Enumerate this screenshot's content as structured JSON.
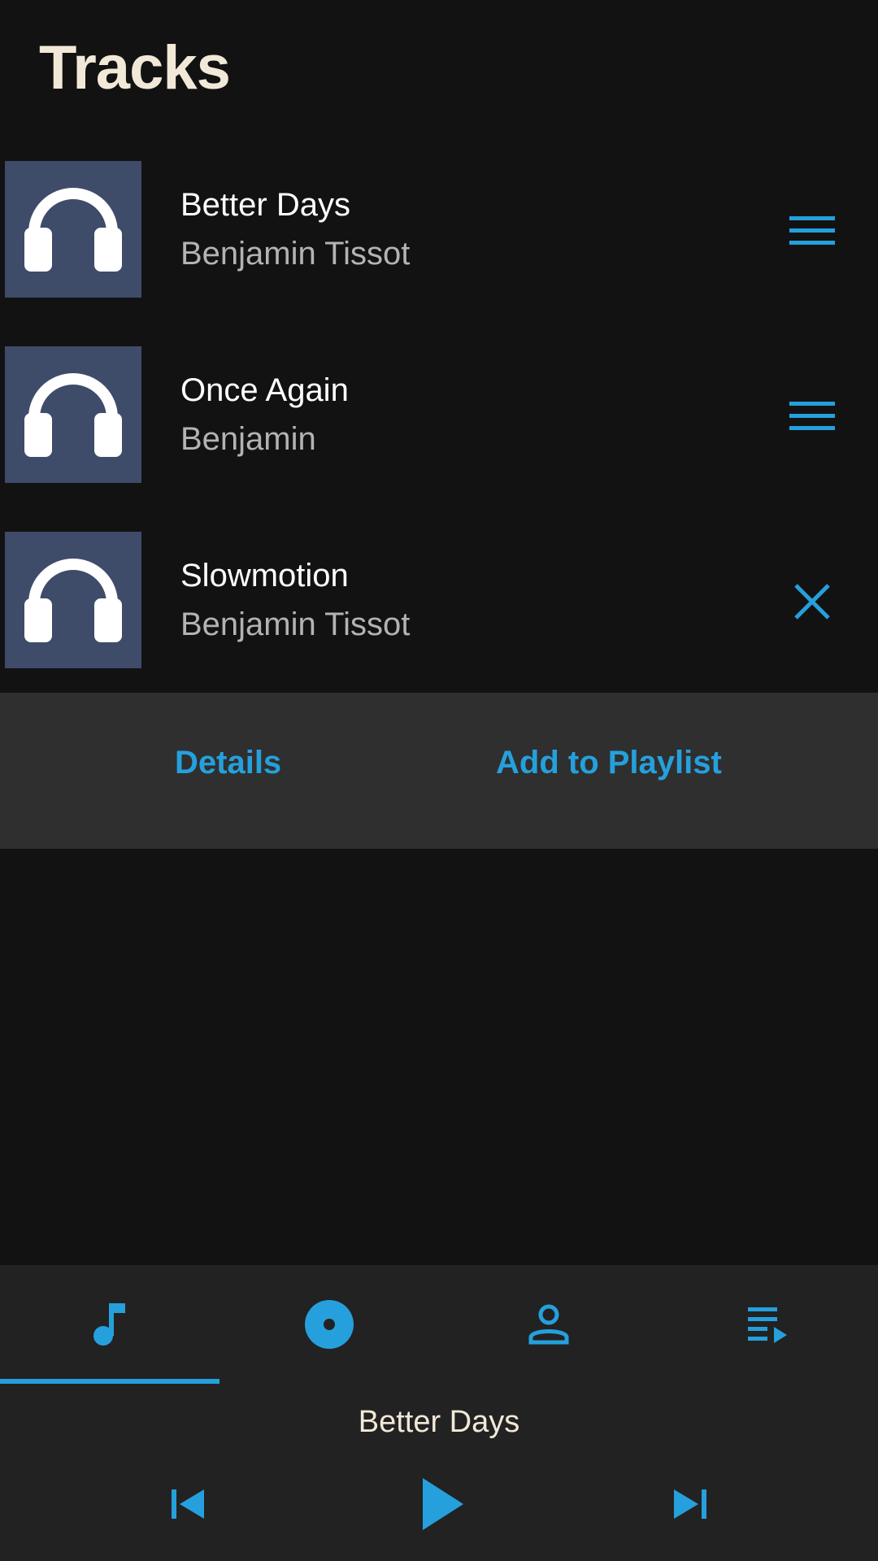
{
  "header": {
    "title": "Tracks"
  },
  "tracks": [
    {
      "title": "Better Days",
      "artist": "Benjamin Tissot",
      "action_icon": "menu-icon"
    },
    {
      "title": "Once Again",
      "artist": "Benjamin",
      "action_icon": "menu-icon"
    },
    {
      "title": "Slowmotion",
      "artist": "Benjamin Tissot",
      "action_icon": "close-icon"
    }
  ],
  "action_panel": {
    "details_label": "Details",
    "add_playlist_label": "Add to Playlist"
  },
  "bottom_nav": {
    "tabs": [
      {
        "icon": "music-note-icon",
        "active": true
      },
      {
        "icon": "album-icon",
        "active": false
      },
      {
        "icon": "person-icon",
        "active": false
      },
      {
        "icon": "playlist-play-icon",
        "active": false
      }
    ]
  },
  "player": {
    "now_playing": "Better Days"
  },
  "colors": {
    "accent": "#25a0dc",
    "background": "#121212",
    "panel": "#2f2f2f",
    "bottom_bar": "#222222",
    "artwork": "#3e4c6a",
    "title": "#f2e8d8"
  }
}
